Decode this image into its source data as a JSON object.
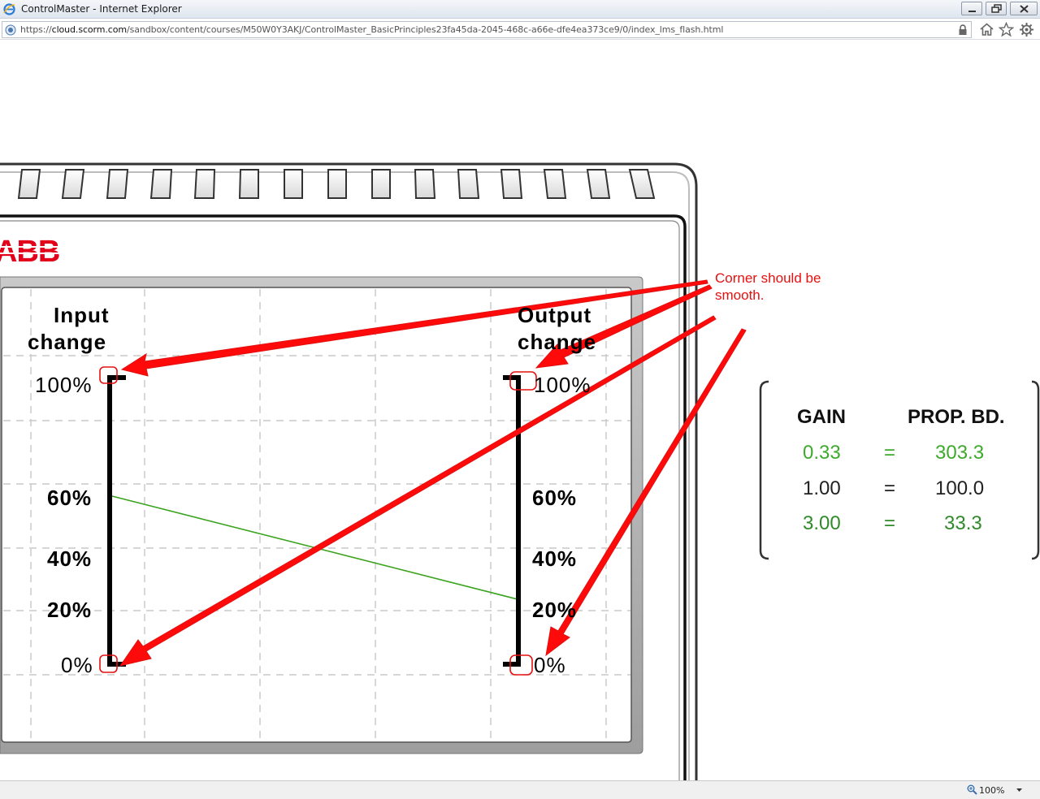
{
  "window": {
    "title": "ControlMaster - Internet Explorer",
    "icons": [
      "ie-logo-icon",
      "minimize-icon",
      "maximize-icon",
      "close-icon"
    ]
  },
  "address": {
    "url_prefix": "https://",
    "url_host": "cloud.scorm.com",
    "url_path": "/sandbox/content/courses/M50W0Y3AKJ/ControlMaster_BasicPrinciples23fa45da-2045-468c-a66e-dfe4ea373ce9/0/index_lms_flash.html",
    "icons": [
      "lock-icon",
      "home-icon",
      "star-icon",
      "gear-icon"
    ]
  },
  "device": {
    "brand": "ABB",
    "input_heading_1": "Input",
    "input_heading_2": "change",
    "output_heading_1": "Output",
    "output_heading_2": "change",
    "input_scale": [
      "100%",
      "60%",
      "40%",
      "20%",
      "0%"
    ],
    "output_scale": [
      "100%",
      "60%",
      "40%",
      "20%",
      "0%"
    ],
    "colors": {
      "trace": "#3aa31e",
      "bar": "#000000",
      "panel": "#ffffff"
    }
  },
  "annotation": {
    "text_line1": "Corner should be",
    "text_line2": "smooth.",
    "color": "#e51010"
  },
  "gain_table": {
    "header_gain": "GAIN",
    "header_pb": "PROP. BD.",
    "rows": [
      {
        "gain": "0.33",
        "eq": "=",
        "pb": "303.3",
        "color": "#3daa2b"
      },
      {
        "gain": "1.00",
        "eq": "=",
        "pb": "100.0",
        "color": "#222222"
      },
      {
        "gain": "3.00",
        "eq": "=",
        "pb": "33.3",
        "color": "#2f8a2a"
      }
    ]
  },
  "statusbar": {
    "zoom": "100%"
  }
}
